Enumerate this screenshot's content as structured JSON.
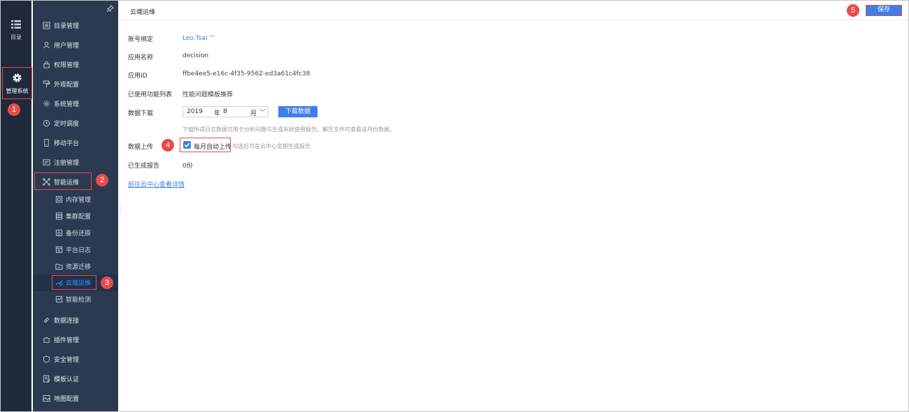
{
  "rail": {
    "directory_label": "目录",
    "admin_label": "管理系统"
  },
  "sidebar": {
    "items": [
      {
        "label": "目录管理"
      },
      {
        "label": "用户管理"
      },
      {
        "label": "权限管理"
      },
      {
        "label": "外观配置"
      },
      {
        "label": "系统管理"
      },
      {
        "label": "定时调度"
      },
      {
        "label": "移动平台"
      },
      {
        "label": "注册管理"
      },
      {
        "label": "智能运维"
      },
      {
        "label": "数据连接"
      },
      {
        "label": "插件管理"
      },
      {
        "label": "安全管理"
      },
      {
        "label": "模板认证"
      },
      {
        "label": "地图配置"
      }
    ],
    "sub_items": [
      {
        "label": "内存管理"
      },
      {
        "label": "集群配置"
      },
      {
        "label": "备份还原"
      },
      {
        "label": "平台日志"
      },
      {
        "label": "资源迁移"
      },
      {
        "label": "云端运维"
      },
      {
        "label": "智能检测"
      }
    ]
  },
  "badges": [
    "1",
    "2",
    "3",
    "4",
    "5"
  ],
  "header": {
    "title": "云端运维",
    "save_label": "保存"
  },
  "form": {
    "account_label": "账号绑定",
    "account_value": "Leo.Tsai",
    "app_name_label": "应用名称",
    "app_name_value": "decision",
    "app_id_label": "应用ID",
    "app_id_value": "ffbe4ee5-e16c-4f35-9562-ed3a61c4fc38",
    "features_label": "已使用功能列表",
    "features_value": "性能问题模板推荐",
    "download_label": "数据下载",
    "year_value": "2019",
    "year_unit": "年",
    "month_value": "8",
    "month_unit": "月",
    "download_button": "下载数据",
    "download_hint": "下载所得日志数据可用于分析问题与生成系统使用报告。解压文件可查看该月份数据。",
    "upload_label": "数据上传",
    "upload_checkbox_label": "每月自动上传",
    "upload_checked": true,
    "upload_hint": "勾选后可在云中心定期生成报告",
    "reports_label": "已生成报告",
    "reports_value": "0份",
    "cloud_link": "前往云中心查看详情"
  },
  "colors": {
    "rail_bg": "#1e2a3c",
    "sidebar_bg": "#2b3a50",
    "accent": "#3d7fe8",
    "highlight": "#e84b4b"
  }
}
